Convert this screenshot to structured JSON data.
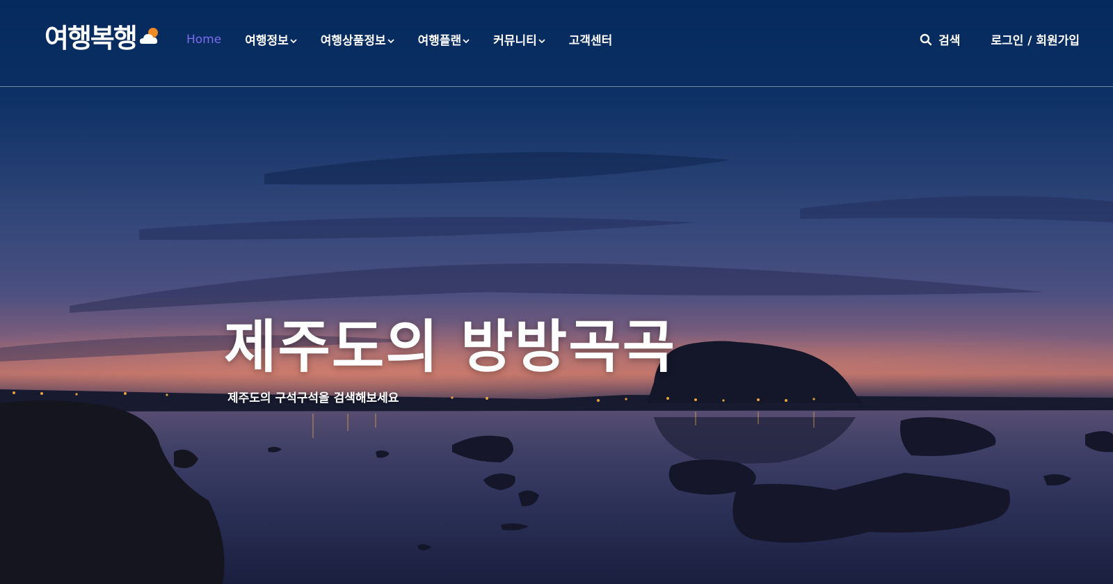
{
  "brand": {
    "logo_text": "여행복행",
    "logo_icon": "cloud-sun-icon"
  },
  "nav": {
    "items": [
      {
        "label": "Home",
        "active": true
      },
      {
        "label": "여행정보",
        "has_dropdown": true
      },
      {
        "label": "여행상품정보",
        "has_dropdown": true
      },
      {
        "label": "여행플랜",
        "has_dropdown": true
      },
      {
        "label": "커뮤니티",
        "has_dropdown": true
      },
      {
        "label": "고객센터"
      }
    ],
    "active_color": "#7b6cf0"
  },
  "header_right": {
    "search_label": "검색",
    "search_icon": "search-icon",
    "auth_label": "로그인 / 회원가입"
  },
  "hero": {
    "title": "제주도의 방방곡곡",
    "subtitle": "제주도의 구석구석을 검색해보세요"
  },
  "colors": {
    "sky_top": "#062a5e",
    "horizon_glow": "#c4746a",
    "water": "#2a2f56",
    "accent": "#7b6cf0",
    "logo_sun": "#f08a24"
  }
}
